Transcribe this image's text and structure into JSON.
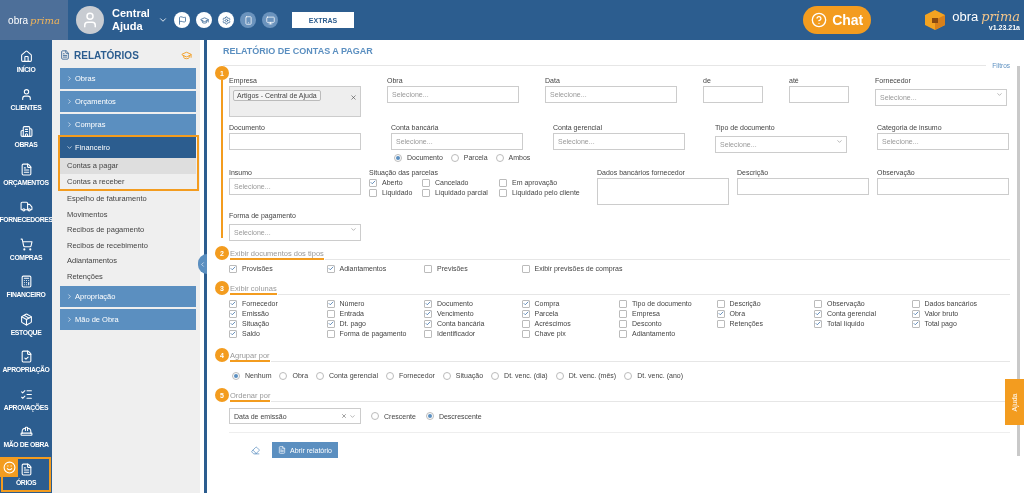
{
  "topbar": {
    "logo": {
      "word1": "obra",
      "word2": "prima"
    },
    "user_name": "Central Ajuda",
    "extras_button": "EXTRAS",
    "chat_button": "Chat",
    "brand": {
      "word1": "obra",
      "word2": "prima"
    },
    "version": "v1.23.21a"
  },
  "nav": [
    {
      "label": "INÍCIO",
      "highlighted": false
    },
    {
      "label": "CLIENTES",
      "highlighted": false
    },
    {
      "label": "OBRAS",
      "highlighted": false
    },
    {
      "label": "ORÇAMENTOS",
      "highlighted": false
    },
    {
      "label": "FORNECEDORES",
      "highlighted": false
    },
    {
      "label": "COMPRAS",
      "highlighted": false
    },
    {
      "label": "FINANCEIRO",
      "highlighted": false
    },
    {
      "label": "ESTOQUE",
      "highlighted": false
    },
    {
      "label": "APROPRIAÇÃO",
      "highlighted": false
    },
    {
      "label": "APROVAÇÕES",
      "highlighted": false
    },
    {
      "label": "MÃO DE OBRA",
      "highlighted": false
    },
    {
      "label": "ÓRIOS",
      "highlighted": true
    }
  ],
  "sidebar": {
    "title": "RELATÓRIOS",
    "groups": [
      {
        "label": "Obras",
        "expanded": false,
        "highlighted": false
      },
      {
        "label": "Orçamentos",
        "expanded": false,
        "highlighted": false
      },
      {
        "label": "Compras",
        "expanded": false,
        "highlighted": false
      },
      {
        "label": "Financeiro",
        "expanded": true,
        "highlighted": true,
        "items": [
          {
            "label": "Contas a pagar",
            "selected": true,
            "highlighted": true
          },
          {
            "label": "Contas a receber",
            "selected": false,
            "highlighted": true
          },
          {
            "label": "Espelho de faturamento",
            "selected": false,
            "highlighted": false
          },
          {
            "label": "Movimentos",
            "selected": false,
            "highlighted": false
          },
          {
            "label": "Recibos de pagamento",
            "selected": false,
            "highlighted": false
          },
          {
            "label": "Recibos de recebimento",
            "selected": false,
            "highlighted": false
          },
          {
            "label": "Adiantamentos",
            "selected": false,
            "highlighted": false
          },
          {
            "label": "Retenções",
            "selected": false,
            "highlighted": false
          }
        ]
      },
      {
        "label": "Apropriação",
        "expanded": false,
        "highlighted": false
      },
      {
        "label": "Mão de Obra",
        "expanded": false,
        "highlighted": false
      }
    ]
  },
  "report": {
    "title": "RELATÓRIO DE CONTAS A PAGAR",
    "filters_link": "Filtros",
    "steps": [
      {
        "number": "1",
        "kind": "fields",
        "rows": [
          [
            {
              "kind": "tags",
              "label": "Empresa",
              "tags": [
                "Artigos - Central de Ajuda"
              ]
            },
            {
              "kind": "search",
              "label": "Obra",
              "placeholder": "Selecione..."
            },
            {
              "kind": "search",
              "label": "Data",
              "placeholder": "Selecione..."
            },
            {
              "kind": "input",
              "label": "de"
            },
            {
              "kind": "input",
              "label": "até"
            },
            {
              "kind": "dropdown",
              "label": "Fornecedor",
              "placeholder": "Selecione..."
            }
          ],
          [
            {
              "kind": "input",
              "label": "Documento"
            },
            {
              "kind": "search",
              "label": "Conta bancária",
              "placeholder": "Selecione...",
              "options": [
                {
                  "label": "Documento",
                  "selected": true
                },
                {
                  "label": "Parcela",
                  "selected": false
                },
                {
                  "label": "Ambos",
                  "selected": false
                }
              ]
            },
            {
              "kind": "search",
              "label": "Conta gerencial",
              "placeholder": "Selecione..."
            },
            {
              "kind": "dropdown",
              "label": "Tipo de documento",
              "placeholder": "Selecione..."
            },
            {
              "kind": "search",
              "label": "Categoria de insumo",
              "placeholder": "Selecione..."
            }
          ],
          [
            {
              "kind": "search",
              "label": "Insumo",
              "placeholder": "Selecione..."
            },
            {
              "kind": "checks",
              "label": "Situação das parcelas",
              "options": [
                {
                  "label": "Aberto",
                  "checked": true
                },
                {
                  "label": "Cancelado",
                  "checked": false
                },
                {
                  "label": "Em aprovação",
                  "checked": false
                },
                {
                  "label": "Liquidado",
                  "checked": false
                },
                {
                  "label": "Liquidado parcial",
                  "checked": false
                },
                {
                  "label": "Liquidado pelo cliente",
                  "checked": false
                }
              ]
            },
            {
              "kind": "textarea",
              "label": "Dados bancários fornecedor"
            },
            {
              "kind": "input",
              "label": "Descrição"
            },
            {
              "kind": "input",
              "label": "Observação"
            }
          ],
          [
            {
              "kind": "dropdown",
              "label": "Forma de pagamento",
              "placeholder": "Selecione..."
            }
          ]
        ]
      },
      {
        "number": "2",
        "kind": "checks",
        "heading": "Exibir documentos dos tipos",
        "options": [
          {
            "label": "Provisões",
            "checked": true
          },
          {
            "label": "Adiantamentos",
            "checked": true
          },
          {
            "label": "Previsões",
            "checked": false
          },
          {
            "label": "Exibir previsões de compras",
            "checked": false
          }
        ]
      },
      {
        "number": "3",
        "kind": "checks",
        "heading": "Exibir colunas",
        "options": [
          {
            "label": "Fornecedor",
            "checked": true
          },
          {
            "label": "Número",
            "checked": true
          },
          {
            "label": "Documento",
            "checked": true
          },
          {
            "label": "Compra",
            "checked": true
          },
          {
            "label": "Tipo de documento",
            "checked": false
          },
          {
            "label": "Descrição",
            "checked": false
          },
          {
            "label": "Observação",
            "checked": false
          },
          {
            "label": "Dados bancários",
            "checked": false
          },
          {
            "label": "Emissão",
            "checked": true
          },
          {
            "label": "Entrada",
            "checked": false
          },
          {
            "label": "Vencimento",
            "checked": true
          },
          {
            "label": "Parcela",
            "checked": true
          },
          {
            "label": "Empresa",
            "checked": false
          },
          {
            "label": "Obra",
            "checked": true
          },
          {
            "label": "Conta gerencial",
            "checked": true
          },
          {
            "label": "Valor bruto",
            "checked": true
          },
          {
            "label": "Situação",
            "checked": true
          },
          {
            "label": "Dt. pago",
            "checked": true
          },
          {
            "label": "Conta bancária",
            "checked": true
          },
          {
            "label": "Acréscimos",
            "checked": false
          },
          {
            "label": "Desconto",
            "checked": false
          },
          {
            "label": "Retenções",
            "checked": false
          },
          {
            "label": "Total líquido",
            "checked": true
          },
          {
            "label": "Total pago",
            "checked": true
          },
          {
            "label": "Saldo",
            "checked": true
          },
          {
            "label": "Forma de pagamento",
            "checked": false
          },
          {
            "label": "Identificador",
            "checked": false
          },
          {
            "label": "Chave pix",
            "checked": false
          },
          {
            "label": "Adiantamento",
            "checked": false
          }
        ]
      },
      {
        "number": "4",
        "kind": "radios",
        "heading": "Agrupar por",
        "options": [
          {
            "label": "Nenhum",
            "selected": true
          },
          {
            "label": "Obra",
            "selected": false
          },
          {
            "label": "Conta gerencial",
            "selected": false
          },
          {
            "label": "Fornecedor",
            "selected": false
          },
          {
            "label": "Situação",
            "selected": false
          },
          {
            "label": "Dt. venc. (dia)",
            "selected": false
          },
          {
            "label": "Dt. venc. (mês)",
            "selected": false
          },
          {
            "label": "Dt. venc. (ano)",
            "selected": false
          }
        ]
      },
      {
        "number": "5",
        "kind": "sort",
        "heading": "Ordenar por",
        "value": "Data de emissão",
        "options": [
          {
            "label": "Crescente",
            "selected": false
          },
          {
            "label": "Descrescente",
            "selected": true
          }
        ]
      }
    ],
    "open_button": "Abrir relatório"
  },
  "help_tab": "Ajuda"
}
